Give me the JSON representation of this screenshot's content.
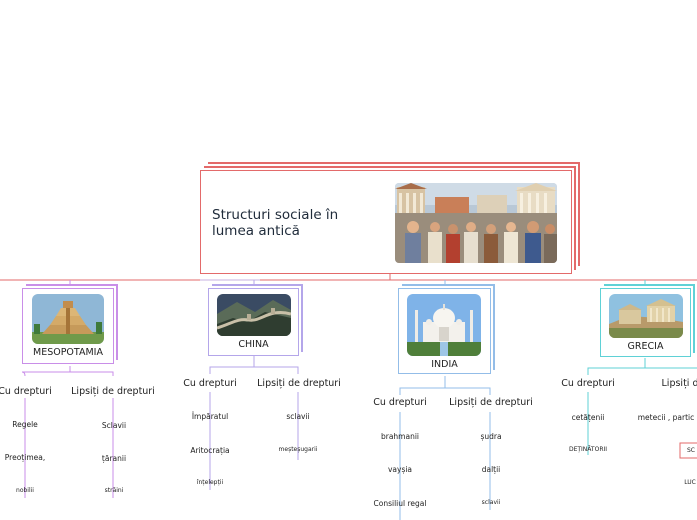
{
  "root": {
    "title": "Structuri  sociale în lumea antică"
  },
  "civilizations": {
    "mesopotamia": {
      "name": "MESOPOTAMIA",
      "with_rights": {
        "label": "Cu drepturi",
        "items": [
          "Regele",
          "Preoțimea,",
          "nobilii"
        ]
      },
      "without_rights": {
        "label": "Lipsiți de drepturi",
        "items": [
          "Sclavii",
          "țăranii",
          "străini"
        ]
      }
    },
    "china": {
      "name": "CHINA",
      "with_rights": {
        "label": "Cu drepturi",
        "items": [
          "Împăratul",
          "Aritocrația",
          "înțelepții"
        ]
      },
      "without_rights": {
        "label": "Lipsiți de drepturi",
        "items": [
          "sclavii",
          "meșteșugarii"
        ]
      }
    },
    "india": {
      "name": "INDIA",
      "with_rights": {
        "label": "Cu drepturi",
        "items": [
          "brahmanii",
          "vayșia",
          "Consiliul regal"
        ]
      },
      "without_rights": {
        "label": "Lipsiți de drepturi",
        "items": [
          "șudra",
          "dalții",
          "sclavii"
        ]
      }
    },
    "grecia": {
      "name": "GRECIA",
      "with_rights": {
        "label": "Cu drepturi",
        "items": [
          "cetățenii",
          "DEȚINĂTORII"
        ]
      },
      "without_rights": {
        "label": "Lipsiți d",
        "items": [
          "metecii , partic",
          "SC",
          "LUC"
        ]
      }
    }
  },
  "colors": {
    "root": "#e36a6a",
    "mesopotamia": "#c98ee8",
    "china": "#b4a6ea",
    "india": "#93bde8",
    "grecia": "#5fd1d6"
  }
}
